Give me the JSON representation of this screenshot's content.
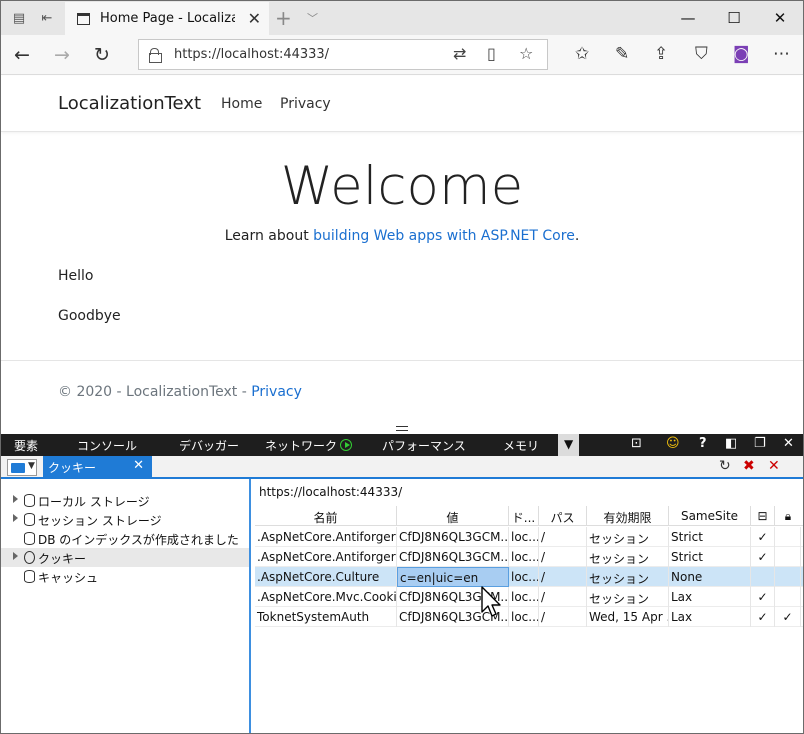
{
  "browser": {
    "tab_title": "Home Page - Localizatic",
    "address": "https://localhost:44333/"
  },
  "site": {
    "brand": "LocalizationText",
    "nav": [
      "Home",
      "Privacy"
    ],
    "welcome": "Welcome",
    "learn_prefix": "Learn about ",
    "learn_link": "building Web apps with ASP.NET Core",
    "learn_suffix": ".",
    "hello": "Hello",
    "goodbye": "Goodbye",
    "footer_prefix": "© 2020 - LocalizationText - ",
    "footer_link": "Privacy"
  },
  "devtools": {
    "tabs": [
      "要素",
      "コンソール",
      "デバッガー",
      "ネットワーク",
      "パフォーマンス",
      "メモリ"
    ],
    "cookie_tab": "クッキー",
    "tree": [
      "ローカル ストレージ",
      "セッション ストレージ",
      "DB のインデックスが作成されました",
      "クッキー",
      "キャッシュ"
    ],
    "origin": "https://localhost:44333/",
    "columns": [
      "名前",
      "値",
      "ド...",
      "パス",
      "有効期限",
      "SameSite"
    ],
    "rows": [
      [
        ".AspNetCore.Antiforgery...",
        "CfDJ8N6QL3GCM...",
        "loc...",
        "/",
        "セッション",
        "Strict",
        "✓",
        ""
      ],
      [
        ".AspNetCore.Antiforgery...",
        "CfDJ8N6QL3GCM...",
        "loc...",
        "/",
        "セッション",
        "Strict",
        "✓",
        ""
      ],
      [
        ".AspNetCore.Culture",
        "c=en|uic=en",
        "loc...",
        "/",
        "セッション",
        "None",
        "",
        ""
      ],
      [
        ".AspNetCore.Mvc.Cooki...",
        "CfDJ8N6QL3GCM...",
        "loc...",
        "/",
        "セッション",
        "Lax",
        "✓",
        ""
      ],
      [
        "ToknetSystemAuth",
        "CfDJ8N6QL3GCM...",
        "loc...",
        "/",
        "Wed, 15 Apr ...",
        "Lax",
        "✓",
        "✓"
      ]
    ]
  },
  "colors": {
    "accent": "#1f7bd6",
    "link": "#1a6fd0",
    "devtools_bar": "#1e1e1e",
    "selected_row": "#cce4f7"
  }
}
